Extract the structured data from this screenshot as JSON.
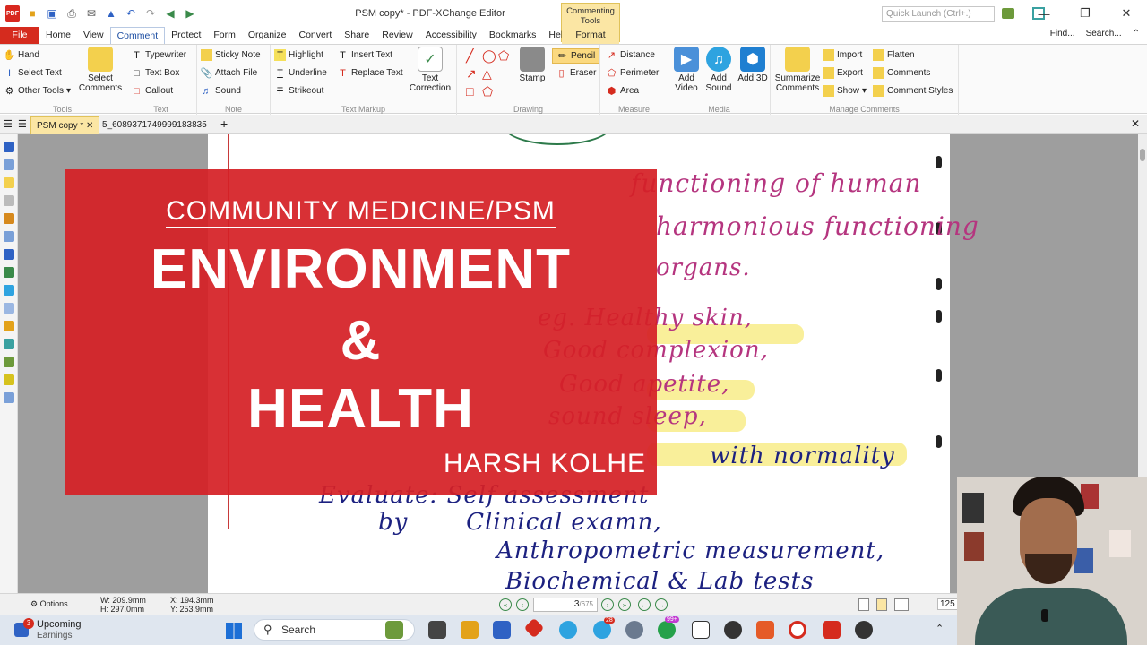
{
  "window": {
    "title": "PSM copy* - PDF-XChange Editor",
    "context_tab_group": "Commenting Tools",
    "quick_launch_placeholder": "Quick Launch (Ctrl+.)"
  },
  "menu_tabs": [
    "File",
    "Home",
    "View",
    "Comment",
    "Protect",
    "Form",
    "Organize",
    "Convert",
    "Share",
    "Review",
    "Accessibility",
    "Bookmarks",
    "Help"
  ],
  "active_tab": "Comment",
  "context_tab": "Format",
  "menu_right": {
    "find": "Find...",
    "search": "Search..."
  },
  "ribbon": {
    "tools": {
      "hand": "Hand",
      "select_text": "Select Text",
      "other_tools": "Other Tools",
      "select_comments": "Select Comments",
      "label": "Tools"
    },
    "text": {
      "typewriter": "Typewriter",
      "text_box": "Text Box",
      "callout": "Callout",
      "label": "Text"
    },
    "note": {
      "sticky_note": "Sticky Note",
      "attach_file": "Attach File",
      "sound": "Sound",
      "label": "Note"
    },
    "text_markup": {
      "highlight": "Highlight",
      "underline": "Underline",
      "strikeout": "Strikeout",
      "insert_text": "Insert Text",
      "replace_text": "Replace Text",
      "text_correction": "Text Correction",
      "label": "Text Markup"
    },
    "drawing": {
      "stamp": "Stamp",
      "pencil": "Pencil",
      "eraser": "Eraser",
      "label": "Drawing"
    },
    "measure": {
      "distance": "Distance",
      "perimeter": "Perimeter",
      "area": "Area",
      "label": "Measure"
    },
    "media": {
      "add_video": "Add Video",
      "add_sound": "Add Sound",
      "add_3d": "Add 3D",
      "label": "Media"
    },
    "manage": {
      "summarize": "Summarize Comments",
      "import": "Import",
      "export": "Export",
      "show": "Show",
      "flatten": "Flatten",
      "comments": "Comments",
      "comment_styles": "Comment Styles",
      "label": "Manage Comments"
    }
  },
  "doc_tabs": [
    "PSM copy *",
    "5_6089371749999183835"
  ],
  "overlay": {
    "subtitle": "COMMUNITY MEDICINE/PSM",
    "line1": "ENVIRONMENT",
    "line2": "&",
    "line3": "HEALTH",
    "author": "HARSH KOLHE"
  },
  "handwriting": {
    "line_a": "functioning of human",
    "line_b": "harmonious functioning",
    "line_c": "organs.",
    "line_d": "eg. Healthy skin,",
    "line_e": "Good complexion,",
    "line_f": "Good apetite,",
    "line_g": "sound sleep,",
    "line_h": "with normality",
    "line_i": "Evaluate: Self assessment",
    "line_j": "by       Clinical examn,",
    "line_k": "Anthropometric measurement,",
    "line_l": "Biochemical & Lab tests"
  },
  "statusbar": {
    "options": "Options...",
    "dims_w": "W: 209.9mm",
    "dims_h": "H: 297.0mm",
    "coord_x": "X: 194.3mm",
    "coord_y": "Y: 253.9mm",
    "page_current": "3",
    "page_total": "/675",
    "zoom": "125"
  },
  "taskbar": {
    "widget_title": "Upcoming",
    "widget_sub": "Earnings",
    "widget_badge": "3",
    "search": "Search",
    "badge_telegram": "28",
    "badge_whatsapp": "99+"
  },
  "colors": {
    "overlay_red": "#d52026",
    "file_tab": "#d52b1e",
    "context_yellow": "#fbe6a4",
    "ink_pink": "#b5357f",
    "ink_navy": "#1c2180",
    "highlighter": "#f9ef9a"
  }
}
